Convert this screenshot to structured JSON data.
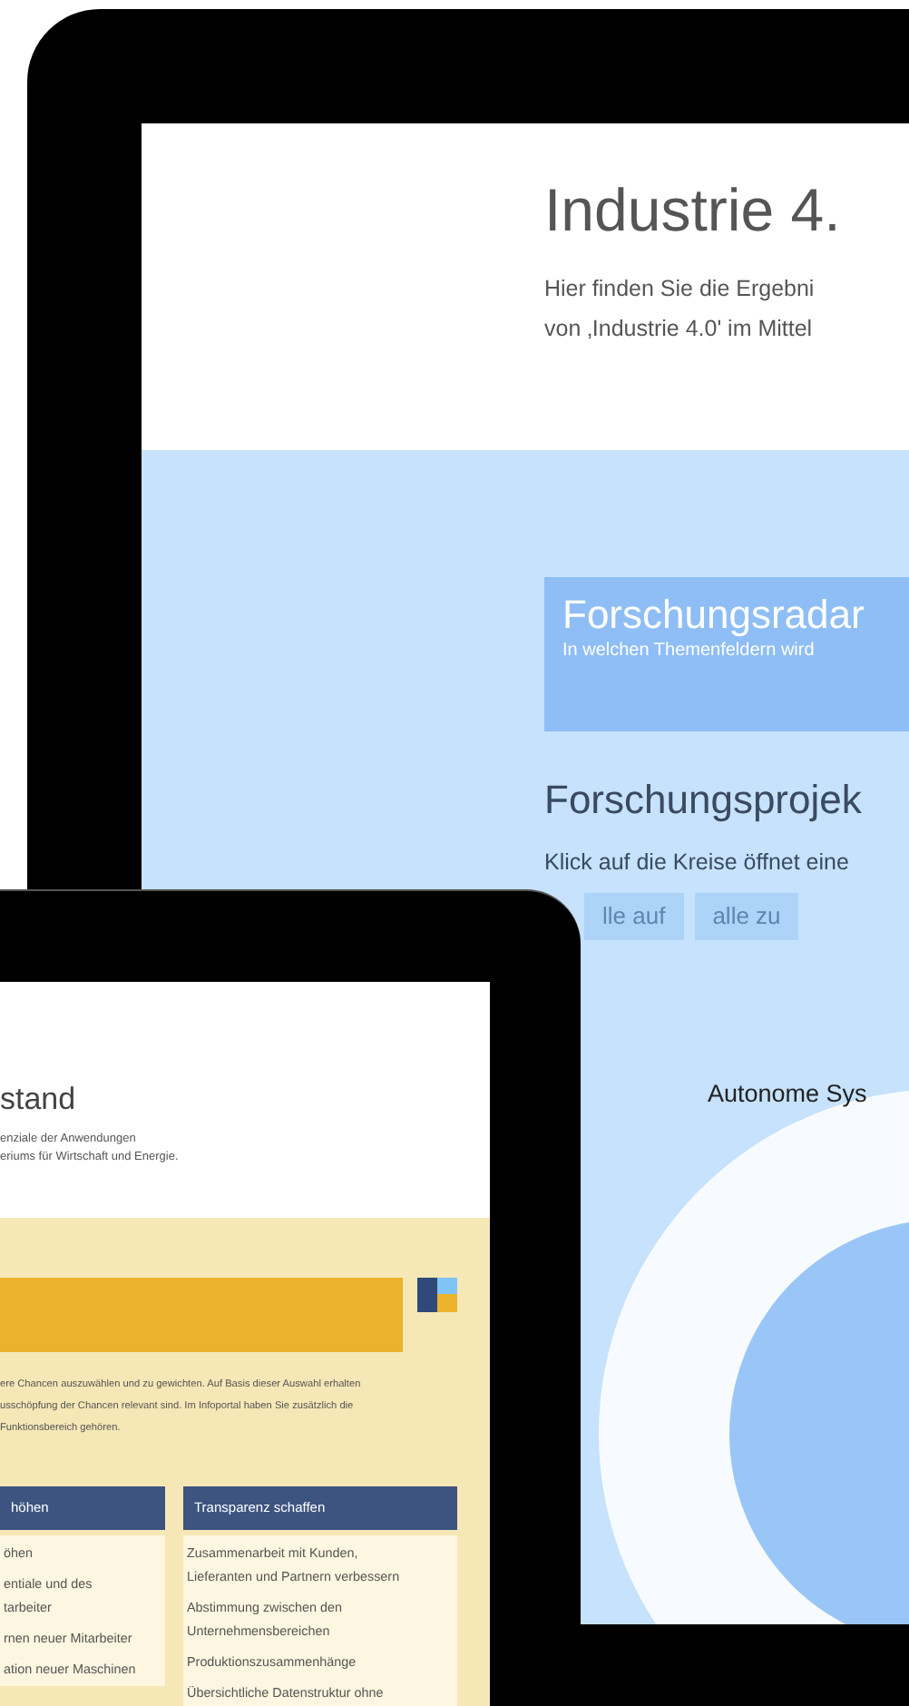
{
  "monitor": {
    "page": {
      "title": "Industrie 4.",
      "intro": [
        "Hier finden Sie die Ergebni",
        "von ‚Industrie 4.0' im Mittel"
      ],
      "radar": {
        "title": "Forschungsradar",
        "subtitle": "In welchen Themenfeldern wird"
      },
      "projects": {
        "heading": "Forschungsprojek",
        "hint": "Klick auf die Kreise öffnet eine",
        "buttons": [
          "lle auf",
          "alle zu"
        ],
        "bubble_label": "Autonome Sys"
      }
    }
  },
  "tablet": {
    "page": {
      "title": "stand",
      "intro": [
        "enziale der Anwendungen",
        "eriums für Wirtschaft und Energie."
      ],
      "description": [
        "ere Chancen auszuwählen und zu gewichten. Auf Basis dieser Auswahl erhalten",
        "usschöpfung der Chancen relevant sind. Im Infoportal haben Sie zusätzlich die",
        "Funktionsbereich gehören."
      ],
      "columns": [
        {
          "heading": "höhen",
          "items": [
            {
              "lines": [
                "öhen"
              ]
            },
            {
              "lines": [
                "entiale und des",
                "tarbeiter"
              ]
            },
            {
              "lines": [
                "rnen neuer Mitarbeiter"
              ]
            },
            {
              "lines": [
                "ation neuer Maschinen"
              ]
            }
          ]
        },
        {
          "heading": "Transparenz schaffen",
          "items": [
            {
              "lines": [
                "Zusammenarbeit mit Kunden,",
                "Lieferanten und Partnern verbessern"
              ]
            },
            {
              "lines": [
                "Abstimmung zwischen den",
                "Unternehmensbereichen"
              ]
            },
            {
              "lines": [
                "Produktionszusammenhänge"
              ]
            },
            {
              "lines": [
                "Übersichtliche Datenstruktur ohne"
              ]
            }
          ]
        }
      ]
    }
  }
}
